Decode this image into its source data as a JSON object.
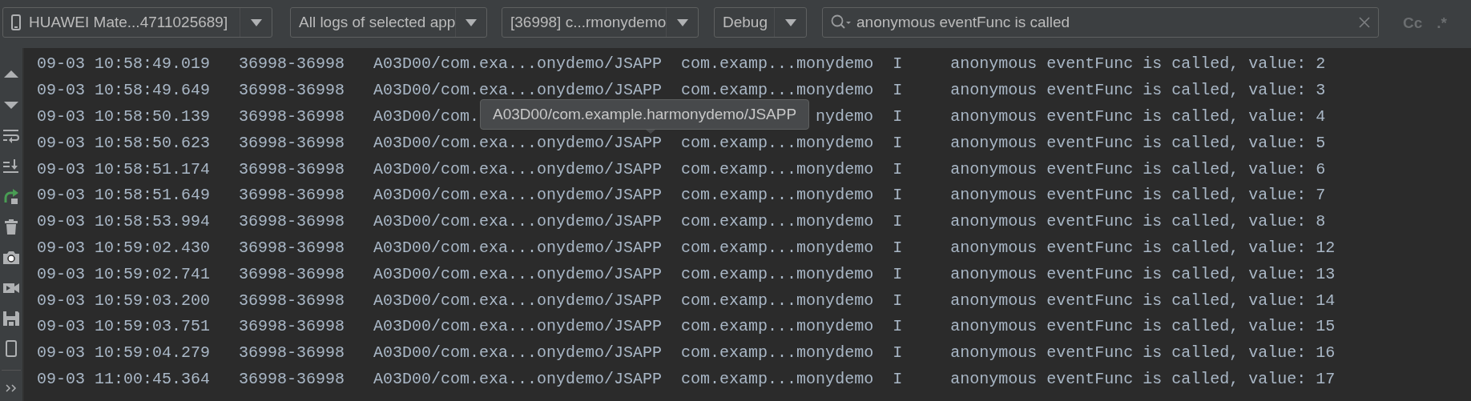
{
  "toolbar": {
    "device_selector": {
      "value": "HUAWEI Mate...4711025689]"
    },
    "log_filter": {
      "value": "All logs of selected app"
    },
    "process_selector": {
      "value": "[36998] c...rmonydemo"
    },
    "level_selector": {
      "value": "Debug"
    },
    "search": {
      "value": "anonymous eventFunc is called"
    },
    "match_case": {
      "label": "Cc",
      "on": false
    },
    "regex": {
      "label": ".*",
      "on": false
    }
  },
  "log_rows": [
    {
      "time": "09-03 10:58:49.019",
      "pid": "36998-36998",
      "tag": "A03D00/com.exa...onydemo/JSAPP",
      "package": "com.examp...monydemo",
      "level": "I",
      "message": "anonymous eventFunc is called, value: 2"
    },
    {
      "time": "09-03 10:58:49.649",
      "pid": "36998-36998",
      "tag": "A03D00/com.exa...onydemo/JSAPP",
      "package": "com.examp...monydemo",
      "level": "I",
      "message": "anonymous eventFunc is called, value: 3"
    },
    {
      "time": "09-03 10:58:50.139",
      "pid": "36998-36998",
      "tag": "A03D00/com.",
      "package": "nydemo",
      "level": "I",
      "message": "anonymous eventFunc is called, value: 4"
    },
    {
      "time": "09-03 10:58:50.623",
      "pid": "36998-36998",
      "tag": "A03D00/com.exa...onydemo/JSAPP",
      "package": "com.examp...monydemo",
      "level": "I",
      "message": "anonymous eventFunc is called, value: 5"
    },
    {
      "time": "09-03 10:58:51.174",
      "pid": "36998-36998",
      "tag": "A03D00/com.exa...onydemo/JSAPP",
      "package": "com.examp...monydemo",
      "level": "I",
      "message": "anonymous eventFunc is called, value: 6"
    },
    {
      "time": "09-03 10:58:51.649",
      "pid": "36998-36998",
      "tag": "A03D00/com.exa...onydemo/JSAPP",
      "package": "com.examp...monydemo",
      "level": "I",
      "message": "anonymous eventFunc is called, value: 7"
    },
    {
      "time": "09-03 10:58:53.994",
      "pid": "36998-36998",
      "tag": "A03D00/com.exa...onydemo/JSAPP",
      "package": "com.examp...monydemo",
      "level": "I",
      "message": "anonymous eventFunc is called, value: 8"
    },
    {
      "time": "09-03 10:59:02.430",
      "pid": "36998-36998",
      "tag": "A03D00/com.exa...onydemo/JSAPP",
      "package": "com.examp...monydemo",
      "level": "I",
      "message": "anonymous eventFunc is called, value: 12"
    },
    {
      "time": "09-03 10:59:02.741",
      "pid": "36998-36998",
      "tag": "A03D00/com.exa...onydemo/JSAPP",
      "package": "com.examp...monydemo",
      "level": "I",
      "message": "anonymous eventFunc is called, value: 13"
    },
    {
      "time": "09-03 10:59:03.200",
      "pid": "36998-36998",
      "tag": "A03D00/com.exa...onydemo/JSAPP",
      "package": "com.examp...monydemo",
      "level": "I",
      "message": "anonymous eventFunc is called, value: 14"
    },
    {
      "time": "09-03 10:59:03.751",
      "pid": "36998-36998",
      "tag": "A03D00/com.exa...onydemo/JSAPP",
      "package": "com.examp...monydemo",
      "level": "I",
      "message": "anonymous eventFunc is called, value: 15"
    },
    {
      "time": "09-03 10:59:04.279",
      "pid": "36998-36998",
      "tag": "A03D00/com.exa...onydemo/JSAPP",
      "package": "com.examp...monydemo",
      "level": "I",
      "message": "anonymous eventFunc is called, value: 16"
    },
    {
      "time": "09-03 11:00:45.364",
      "pid": "36998-36998",
      "tag": "A03D00/com.exa...onydemo/JSAPP",
      "package": "com.examp...monydemo",
      "level": "I",
      "message": "anonymous eventFunc is called, value: 17"
    }
  ],
  "tooltip": {
    "text": "A03D00/com.example.harmonydemo/JSAPP"
  }
}
